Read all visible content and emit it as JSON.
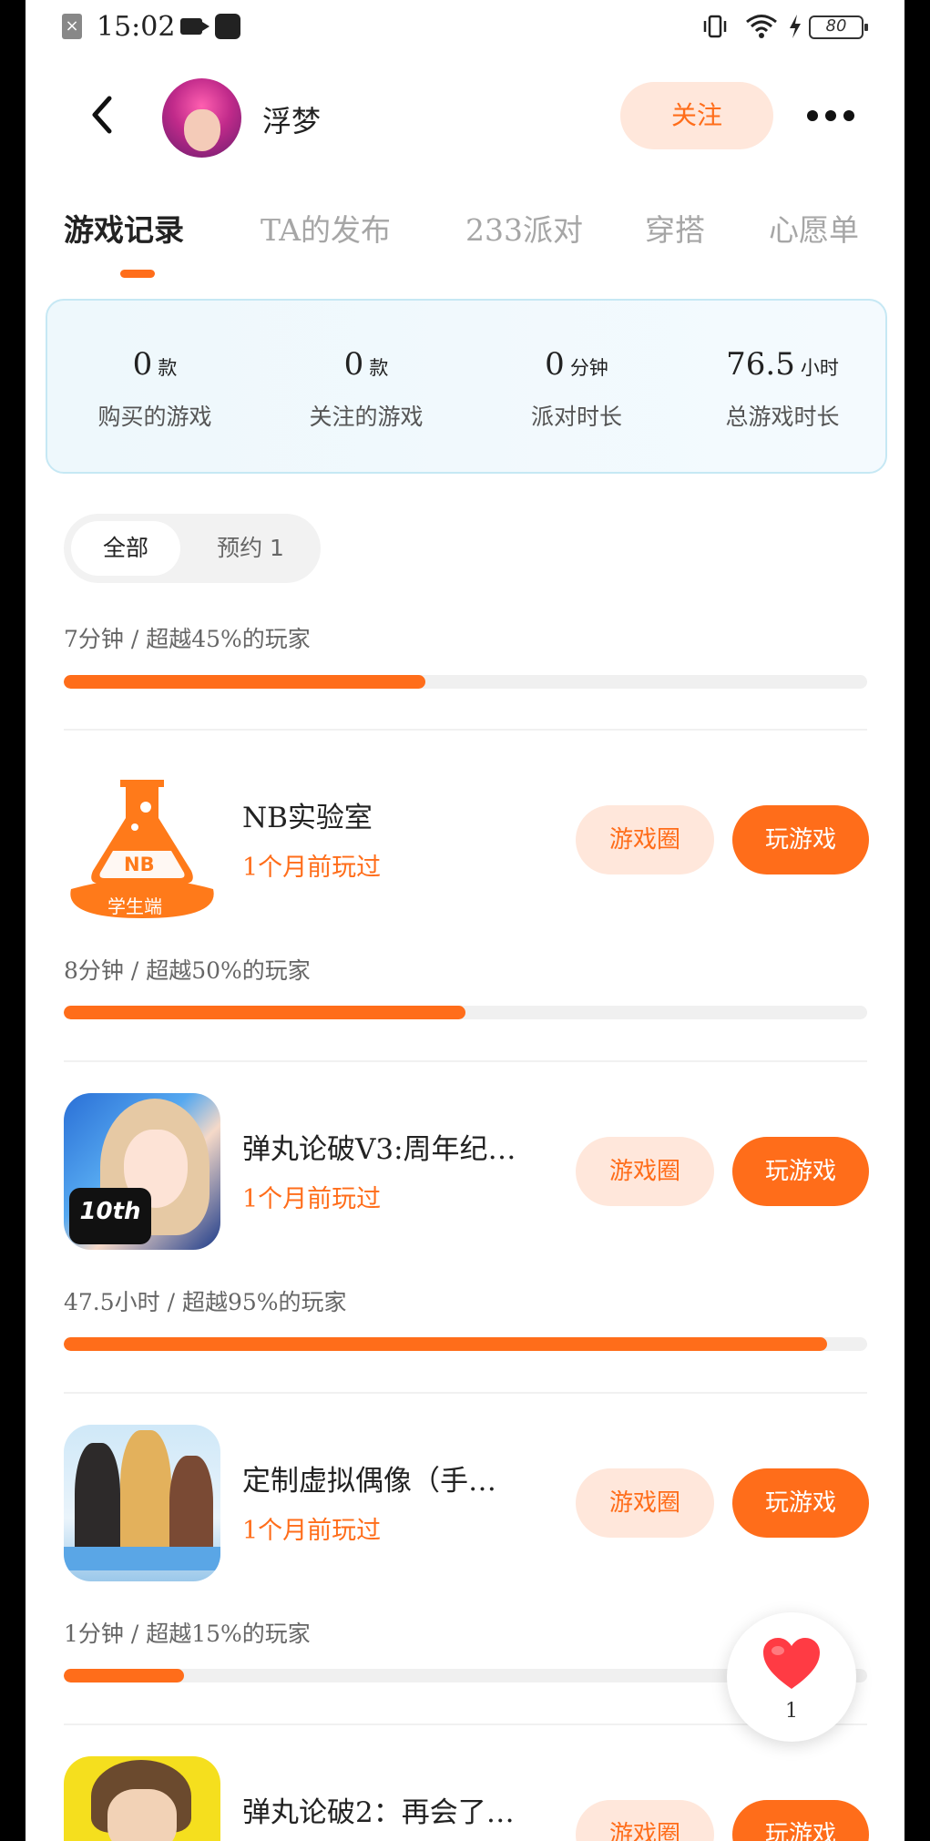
{
  "status_bar": {
    "time": "15:02",
    "battery": "80"
  },
  "header": {
    "username": "浮梦",
    "follow_label": "关注"
  },
  "tabs": [
    {
      "label": "游戏记录",
      "active": true
    },
    {
      "label": "TA的发布",
      "active": false
    },
    {
      "label": "233派对",
      "active": false
    },
    {
      "label": "穿搭",
      "active": false
    },
    {
      "label": "心愿单",
      "active": false
    }
  ],
  "stats": [
    {
      "value": "0",
      "unit": "款",
      "label": "购买的游戏"
    },
    {
      "value": "0",
      "unit": "款",
      "label": "关注的游戏"
    },
    {
      "value": "0",
      "unit": "分钟",
      "label": "派对时长"
    },
    {
      "value": "76.5",
      "unit": "小时",
      "label": "总游戏时长"
    }
  ],
  "filters": {
    "all": "全部",
    "reserve": "预约 1"
  },
  "top_progress": {
    "text": "7分钟 / 超越45%的玩家",
    "fraction": 0.45
  },
  "games": [
    {
      "title": "NB实验室",
      "sub": "1个月前玩过",
      "icon": "nb-lab-icon",
      "icon_label": "NB",
      "icon_ribbon": "学生端",
      "circle_label": "游戏圈",
      "play_label": "玩游戏",
      "progress": {
        "text": "8分钟 / 超越50%的玩家",
        "fraction": 0.5
      }
    },
    {
      "title": "弹丸论破V3:周年纪…",
      "sub": "1个月前玩过",
      "icon": "danganronpa-v3-icon",
      "icon_badge": "10th",
      "circle_label": "游戏圈",
      "play_label": "玩游戏",
      "progress": {
        "text": "47.5小时 / 超越95%的玩家",
        "fraction": 0.95
      }
    },
    {
      "title": "定制虚拟偶像（手…",
      "sub": "1个月前玩过",
      "icon": "virtual-idol-icon",
      "circle_label": "游戏圈",
      "play_label": "玩游戏",
      "progress": {
        "text": "1分钟 / 超越15%的玩家",
        "fraction": 0.15
      }
    },
    {
      "title": "弹丸论破2：再会了…",
      "sub": "",
      "icon": "danganronpa-2-icon",
      "circle_label": "游戏圈",
      "play_label": "玩游戏"
    }
  ],
  "like": {
    "count": "1"
  },
  "colors": {
    "accent": "#ff6d1a",
    "accent_light": "#ffe7db",
    "card_border": "#c6e8f4"
  }
}
